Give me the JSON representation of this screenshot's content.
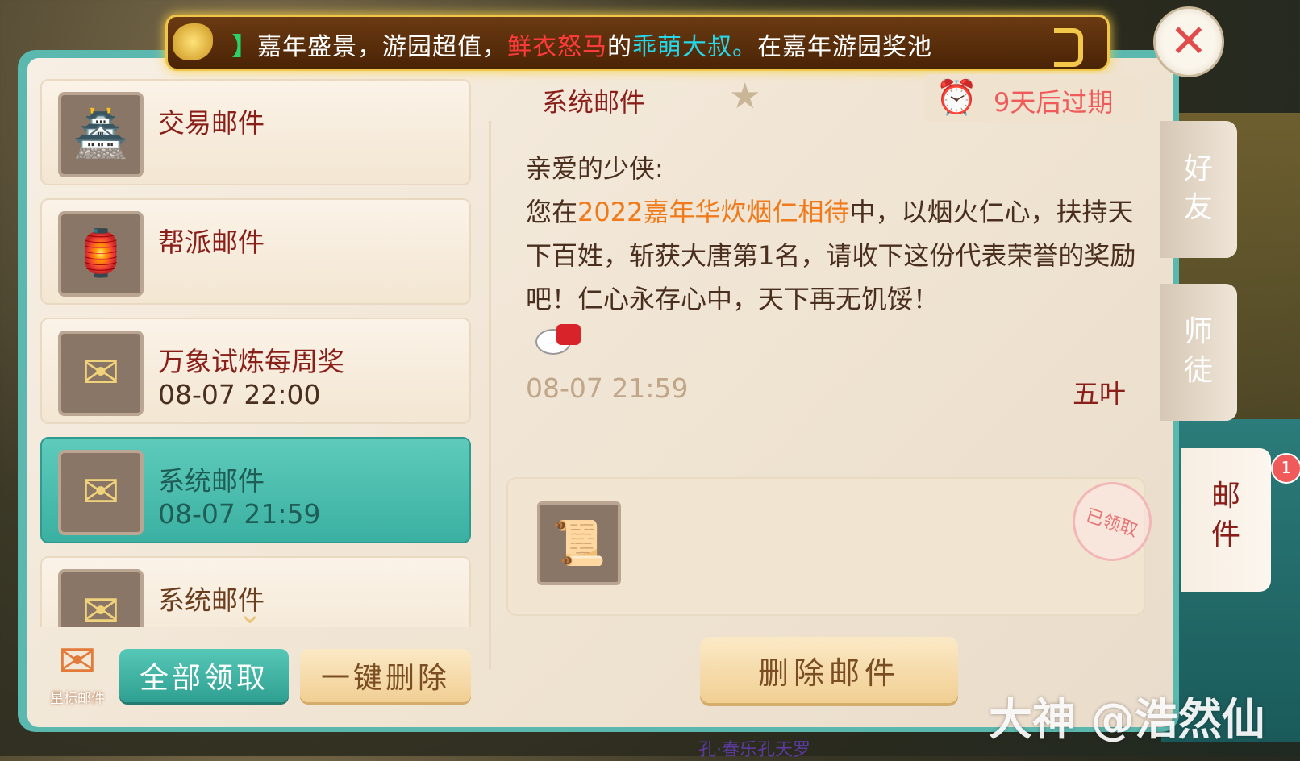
{
  "banner": {
    "prefix": "】",
    "part1": "嘉年盛景，游园超值，",
    "part2": "鲜衣怒马",
    "part3": "的",
    "part4": "乖萌大叔。",
    "part5": "在嘉年游园奖池"
  },
  "mail_list": {
    "items": [
      {
        "title": "交易邮件",
        "date": "",
        "icon": "trade-shop-icon",
        "glyph": "🏯"
      },
      {
        "title": "帮派邮件",
        "date": "",
        "icon": "guild-house-icon",
        "glyph": "🏮"
      },
      {
        "title": "万象试炼每周奖",
        "date": "08-07 22:00",
        "icon": "envelope-icon",
        "glyph": "✉"
      },
      {
        "title": "系统邮件",
        "date": "08-07 21:59",
        "icon": "open-envelope-icon",
        "glyph": "✉",
        "selected": true
      },
      {
        "title": "系统邮件",
        "date": "",
        "icon": "open-envelope-icon",
        "glyph": "✉"
      }
    ]
  },
  "bottom_left": {
    "star_mail_label": "星标邮件",
    "collect_all": "全部领取",
    "delete_all": "一键删除"
  },
  "detail": {
    "header_title": "系统邮件",
    "expire": "9天后过期",
    "greeting": "亲爱的少侠:",
    "body_pre": "您在",
    "event_name": "2022嘉年华炊烟仁相待",
    "body_post": "中，以烟火仁心，扶持天下百姓，斩获大唐第1名，请收下这份代表荣誉的奖励吧！仁心永存心中，天下再无饥馁！",
    "time": "08-07 21:59",
    "sender": "五叶",
    "claimed": "已领取",
    "delete_mail": "删除邮件"
  },
  "side_tabs": [
    {
      "label": "好友"
    },
    {
      "label": "师徒"
    },
    {
      "label": "邮件",
      "active": true,
      "badge": "1"
    }
  ],
  "watermark": "大神 @浩然仙",
  "bottom_chat": "孔·春乐孔天罗"
}
